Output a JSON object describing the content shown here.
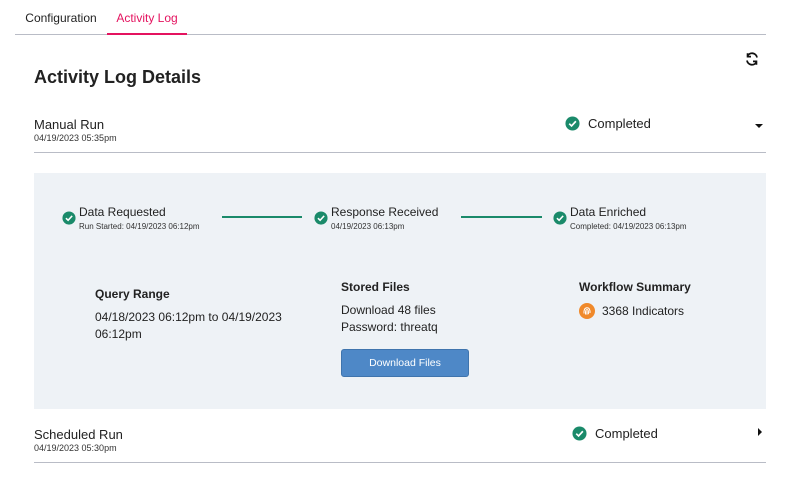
{
  "tabs": [
    {
      "label": "Configuration",
      "active": false
    },
    {
      "label": "Activity Log",
      "active": true
    }
  ],
  "page_title": "Activity Log Details",
  "runs": [
    {
      "name": "Manual Run",
      "date": "04/19/2023 05:35pm",
      "status": "Completed",
      "expanded": true
    },
    {
      "name": "Scheduled Run",
      "date": "04/19/2023 05:30pm",
      "status": "Completed",
      "expanded": false
    }
  ],
  "steps": [
    {
      "label": "Data Requested",
      "sub": "Run Started: 04/19/2023 06:12pm"
    },
    {
      "label": "Response Received",
      "sub": "04/19/2023 06:13pm"
    },
    {
      "label": "Data Enriched",
      "sub": "Completed: 04/19/2023 06:13pm"
    }
  ],
  "query_range": {
    "title": "Query Range",
    "value": "04/18/2023 06:12pm to 04/19/2023 06:12pm"
  },
  "stored_files": {
    "title": "Stored Files",
    "line1": "Download 48 files",
    "line2": "Password: threatq",
    "button": "Download Files"
  },
  "workflow_summary": {
    "title": "Workflow Summary",
    "indicators": "3368 Indicators"
  },
  "colors": {
    "accent": "#e4135f",
    "success": "#1a8a6a",
    "button": "#4e88c7",
    "panel": "#eef2f6",
    "indicator_icon": "#f0892a"
  },
  "icons": {
    "refresh": "refresh-icon",
    "status": "check-circle-icon",
    "expand": "chevron-down-icon",
    "collapse": "chevron-right-icon",
    "indicator": "fingerprint-icon"
  }
}
